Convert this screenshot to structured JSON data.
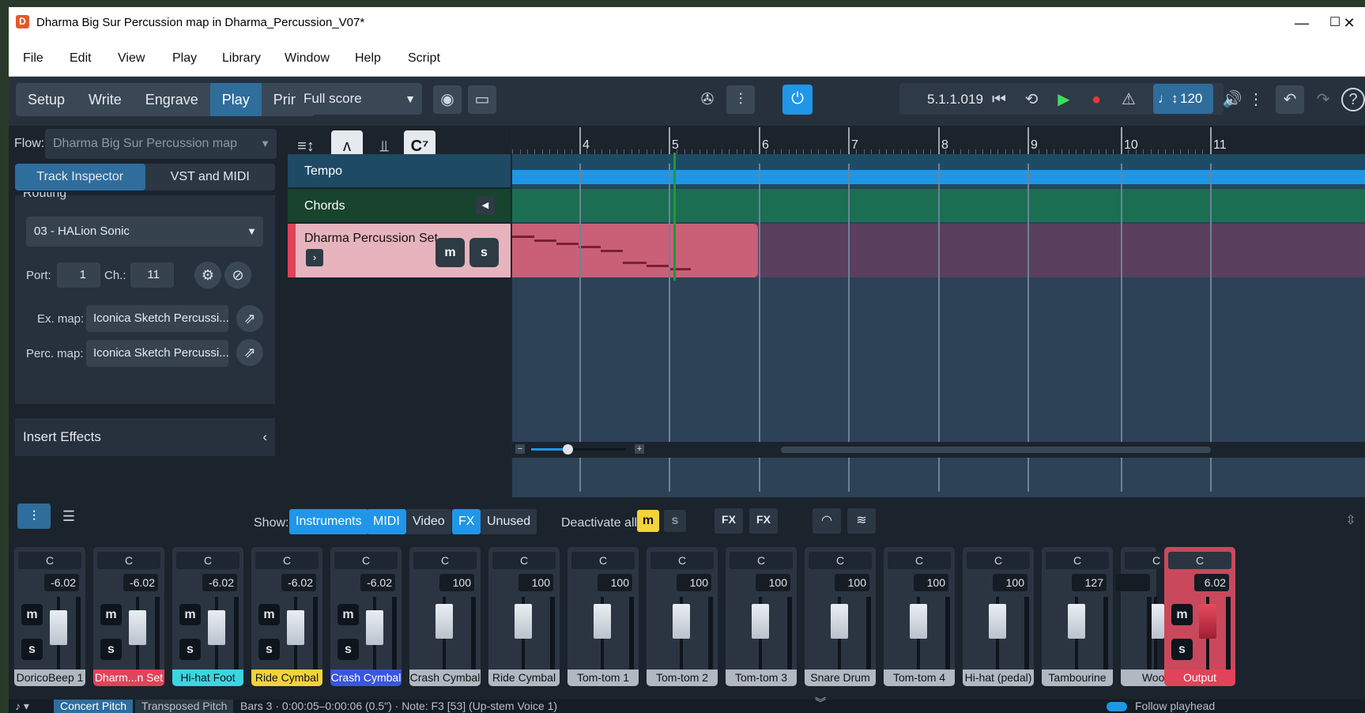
{
  "window": {
    "title": "Dharma Big Sur Percussion map in Dharma_Percussion_V07*",
    "icon": "D",
    "min": "—",
    "max": "☐",
    "close": "✕"
  },
  "menu": [
    "File",
    "Edit",
    "View",
    "Play",
    "Library",
    "Window",
    "Help",
    "Script"
  ],
  "modes": {
    "tabs": [
      "Setup",
      "Write",
      "Engrave",
      "Play",
      "Print"
    ],
    "active": "Play"
  },
  "layout_select": "Full score",
  "transport": {
    "timecode": "5.1.1.019",
    "tempo": "120"
  },
  "flow": {
    "label": "Flow:",
    "value": "Dharma Big Sur Percussion map"
  },
  "inspector": {
    "tabs": [
      "Track Inspector",
      "VST and MIDI"
    ],
    "active": "Track Inspector",
    "section": "Routing"
  },
  "routing": {
    "device": "03 - HALion Sonic",
    "port_label": "Port:",
    "port": "1",
    "channel_label": "Ch.:",
    "channel": "11",
    "exmap_label": "Ex. map:",
    "exmap": "Iconica Sketch Percussi...",
    "percmap_label": "Perc. map:",
    "percmap": "Iconica Sketch Percussi..."
  },
  "insert_effects": "Insert Effects",
  "tracks": {
    "tempo": "Tempo",
    "chords": "Chords",
    "instrument": "Dharma Percussion Set",
    "mute": "m",
    "solo": "s",
    "chord_icon": "C⁷"
  },
  "ruler": {
    "bars": [
      "4",
      "5",
      "6",
      "7",
      "8",
      "9",
      "10",
      "11"
    ]
  },
  "mixer": {
    "show_label": "Show:",
    "filters": [
      {
        "label": "Instruments",
        "on": true
      },
      {
        "label": "MIDI",
        "on": true
      },
      {
        "label": "Video",
        "on": false
      },
      {
        "label": "FX",
        "on": true
      },
      {
        "label": "Unused",
        "on": false
      }
    ],
    "deactivate_label": "Deactivate all:",
    "deactivate_m": "m",
    "deactivate_s": "s",
    "fx_add": "FX",
    "fx_remove": "FX",
    "channels": [
      {
        "pan": "C",
        "vol": "-6.02",
        "name": "DoricoBeep 1",
        "color": "#b0b8c2",
        "text": "#111"
      },
      {
        "pan": "C",
        "vol": "-6.02",
        "name": "Dharm...n Set",
        "color": "#e0435a",
        "text": "#fff"
      },
      {
        "pan": "C",
        "vol": "-6.02",
        "name": "Hi-hat Foot",
        "color": "#3ad6e0",
        "text": "#111"
      },
      {
        "pan": "C",
        "vol": "-6.02",
        "name": "Ride Cymbal",
        "color": "#f2d33a",
        "text": "#111"
      },
      {
        "pan": "C",
        "vol": "-6.02",
        "name": "Crash Cymbal",
        "color": "#3a55e0",
        "text": "#fff"
      },
      {
        "pan": "C",
        "vol": "100",
        "name": "Crash Cymbal",
        "color": "#b0b8c2",
        "text": "#111"
      },
      {
        "pan": "C",
        "vol": "100",
        "name": "Ride Cymbal",
        "color": "#b0b8c2",
        "text": "#111"
      },
      {
        "pan": "C",
        "vol": "100",
        "name": "Tom-tom 1",
        "color": "#b0b8c2",
        "text": "#111"
      },
      {
        "pan": "C",
        "vol": "100",
        "name": "Tom-tom 2",
        "color": "#b0b8c2",
        "text": "#111"
      },
      {
        "pan": "C",
        "vol": "100",
        "name": "Tom-tom 3",
        "color": "#b0b8c2",
        "text": "#111"
      },
      {
        "pan": "C",
        "vol": "100",
        "name": "Snare Drum",
        "color": "#b0b8c2",
        "text": "#111"
      },
      {
        "pan": "C",
        "vol": "100",
        "name": "Tom-tom 4",
        "color": "#b0b8c2",
        "text": "#111"
      },
      {
        "pan": "C",
        "vol": "100",
        "name": "Hi-hat (pedal)",
        "color": "#b0b8c2",
        "text": "#111"
      },
      {
        "pan": "C",
        "vol": "127",
        "name": "Tambourine",
        "color": "#b0b8c2",
        "text": "#111"
      },
      {
        "pan": "C",
        "vol": "",
        "name": "Wood",
        "color": "#b0b8c2",
        "text": "#111"
      }
    ],
    "output": {
      "pan": "C",
      "vol": "6.02",
      "name": "Output"
    }
  },
  "status": {
    "pitch_modes": [
      "Concert Pitch",
      "Transposed Pitch"
    ],
    "info": "Bars 3 · 0:00:05–0:00:06 (0.5\") · Note: F3 [53] (Up-stem Voice 1)",
    "follow": "Follow playhead"
  }
}
